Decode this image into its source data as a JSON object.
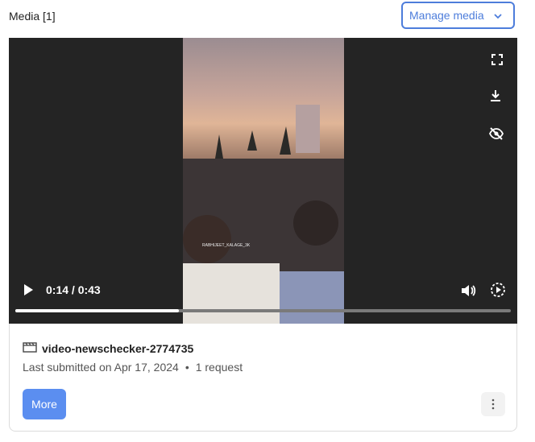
{
  "header": {
    "title": "Media [1]"
  },
  "manage_button": {
    "label": "Manage media",
    "icon": "chevron-down-icon"
  },
  "player": {
    "current_time": "0:14",
    "duration": "0:43",
    "time_display": "0:14 / 0:43",
    "progress": 0.33,
    "watermark": "RABHIJEET_KALAGE_3K",
    "icons": [
      "fullscreen-icon",
      "download-icon",
      "hide-icon",
      "play-icon",
      "volume-icon",
      "playback-speed-icon"
    ]
  },
  "item": {
    "icon": "film-icon",
    "name": "video-newschecker-2774735",
    "submitted": "Last submitted on Apr 17, 2024",
    "separator": "•",
    "requests": "1 request"
  },
  "actions": {
    "more_label": "More",
    "kebab_icon": "kebab-icon"
  },
  "colors": {
    "accent": "#4d7ddb",
    "more_button": "#5b8ef0",
    "player_bg": "#242424"
  }
}
